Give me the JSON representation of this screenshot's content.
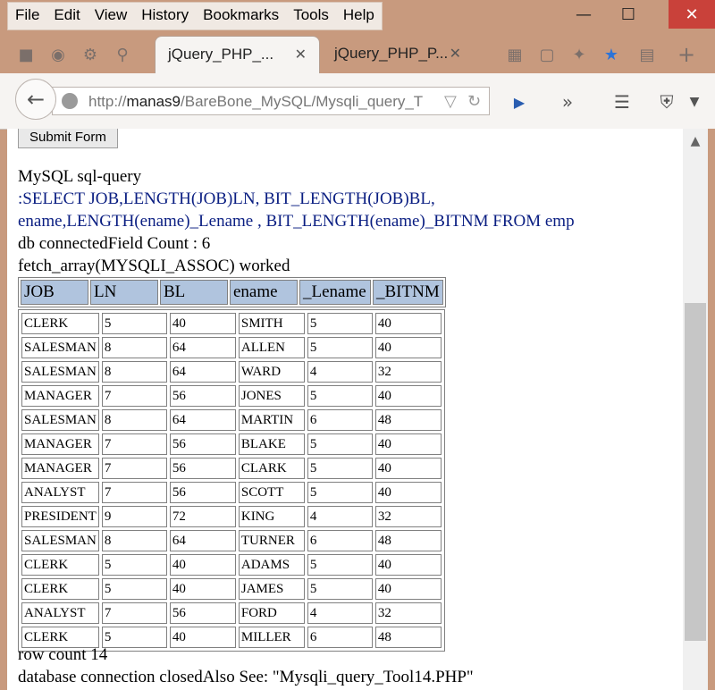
{
  "menu": [
    "File",
    "Edit",
    "View",
    "History",
    "Bookmarks",
    "Tools",
    "Help"
  ],
  "tabs": [
    {
      "label": "jQuery_PHP_...",
      "active": true
    },
    {
      "label": "jQuery_PHP_P...",
      "active": false
    }
  ],
  "address": {
    "prefix": "http://",
    "host": "manas9",
    "path": "/BareBone_MySQL/Mysqli_query_T"
  },
  "page": {
    "submit_label": "Submit Form",
    "sql_heading": "MySQL sql-query",
    "sql_line1": ":SELECT JOB,LENGTH(JOB)LN, BIT_LENGTH(JOB)BL,",
    "sql_line2": "ename,LENGTH(ename)_Lename , BIT_LENGTH(ename)_BITNM FROM emp",
    "db_status": "db connectedField Count : 6",
    "fetch_status": "fetch_array(MYSQLI_ASSOC) worked",
    "row_count": "row count 14",
    "footer": "database connection closedAlso See: \"Mysqli_query_Tool14.PHP\""
  },
  "table": {
    "columns": [
      "JOB",
      "LN",
      "BL",
      "ename",
      "_Lename",
      "_BITNM"
    ],
    "rows": [
      [
        "CLERK",
        "5",
        "40",
        "SMITH",
        "5",
        "40"
      ],
      [
        "SALESMAN",
        "8",
        "64",
        "ALLEN",
        "5",
        "40"
      ],
      [
        "SALESMAN",
        "8",
        "64",
        "WARD",
        "4",
        "32"
      ],
      [
        "MANAGER",
        "7",
        "56",
        "JONES",
        "5",
        "40"
      ],
      [
        "SALESMAN",
        "8",
        "64",
        "MARTIN",
        "6",
        "48"
      ],
      [
        "MANAGER",
        "7",
        "56",
        "BLAKE",
        "5",
        "40"
      ],
      [
        "MANAGER",
        "7",
        "56",
        "CLARK",
        "5",
        "40"
      ],
      [
        "ANALYST",
        "7",
        "56",
        "SCOTT",
        "5",
        "40"
      ],
      [
        "PRESIDENT",
        "9",
        "72",
        "KING",
        "4",
        "32"
      ],
      [
        "SALESMAN",
        "8",
        "64",
        "TURNER",
        "6",
        "48"
      ],
      [
        "CLERK",
        "5",
        "40",
        "ADAMS",
        "5",
        "40"
      ],
      [
        "CLERK",
        "5",
        "40",
        "JAMES",
        "5",
        "40"
      ],
      [
        "ANALYST",
        "7",
        "56",
        "FORD",
        "4",
        "32"
      ],
      [
        "CLERK",
        "5",
        "40",
        "MILLER",
        "6",
        "48"
      ]
    ]
  }
}
